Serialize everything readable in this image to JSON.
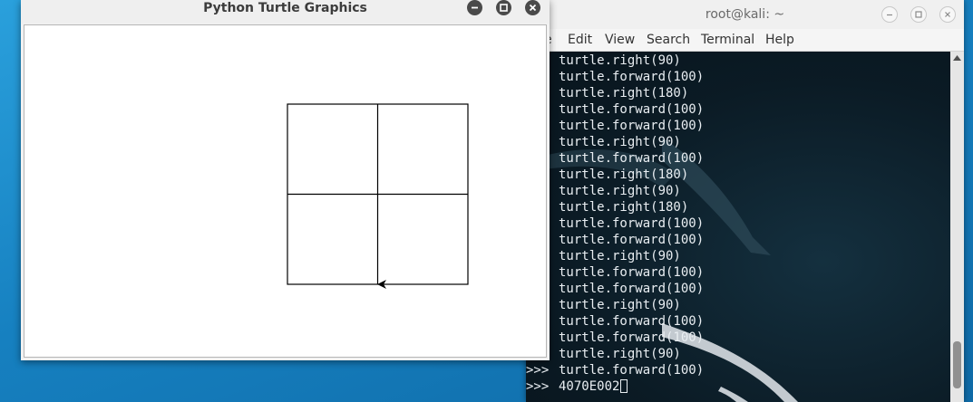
{
  "turtle_window": {
    "title": "Python Turtle Graphics",
    "controls": [
      "minimize-icon",
      "maximize-icon",
      "close-icon"
    ]
  },
  "terminal_window": {
    "title": "root@kali: ~",
    "controls": [
      "minimize-icon",
      "maximize-icon",
      "close-icon"
    ],
    "menu": [
      "e",
      "Edit",
      "View",
      "Search",
      "Terminal",
      "Help"
    ],
    "lines": [
      {
        "prompt": "",
        "text": "turtle.right(90)"
      },
      {
        "prompt": "",
        "text": "turtle.forward(100)"
      },
      {
        "prompt": "",
        "text": "turtle.right(180)"
      },
      {
        "prompt": "",
        "text": "turtle.forward(100)"
      },
      {
        "prompt": "",
        "text": "turtle.forward(100)"
      },
      {
        "prompt": "",
        "text": "turtle.right(90)"
      },
      {
        "prompt": "",
        "text": "turtle.forward(100)"
      },
      {
        "prompt": "",
        "text": "turtle.right(180)"
      },
      {
        "prompt": "",
        "text": "turtle.right(90)"
      },
      {
        "prompt": "",
        "text": "turtle.right(180)"
      },
      {
        "prompt": "",
        "text": "turtle.forward(100)"
      },
      {
        "prompt": "",
        "text": "turtle.forward(100)"
      },
      {
        "prompt": "",
        "text": "turtle.right(90)"
      },
      {
        "prompt": "",
        "text": "turtle.forward(100)"
      },
      {
        "prompt": "",
        "text": "turtle.forward(100)"
      },
      {
        "prompt": "",
        "text": "turtle.right(90)"
      },
      {
        "prompt": "",
        "text": "turtle.forward(100)"
      },
      {
        "prompt": "",
        "text": "turtle.forward(100)"
      },
      {
        "prompt": "",
        "text": "turtle.right(90)"
      },
      {
        "prompt": ">>>",
        "text": "turtle.forward(100)"
      }
    ],
    "input_line": {
      "prompt": ">>>",
      "text": "4070E002"
    }
  },
  "colors": {
    "desktop": "#1b86c4",
    "terminal_bg": "#0c1c26",
    "terminal_text": "#e9eef2",
    "canvas": "#ffffff",
    "drawing": "#000000"
  }
}
